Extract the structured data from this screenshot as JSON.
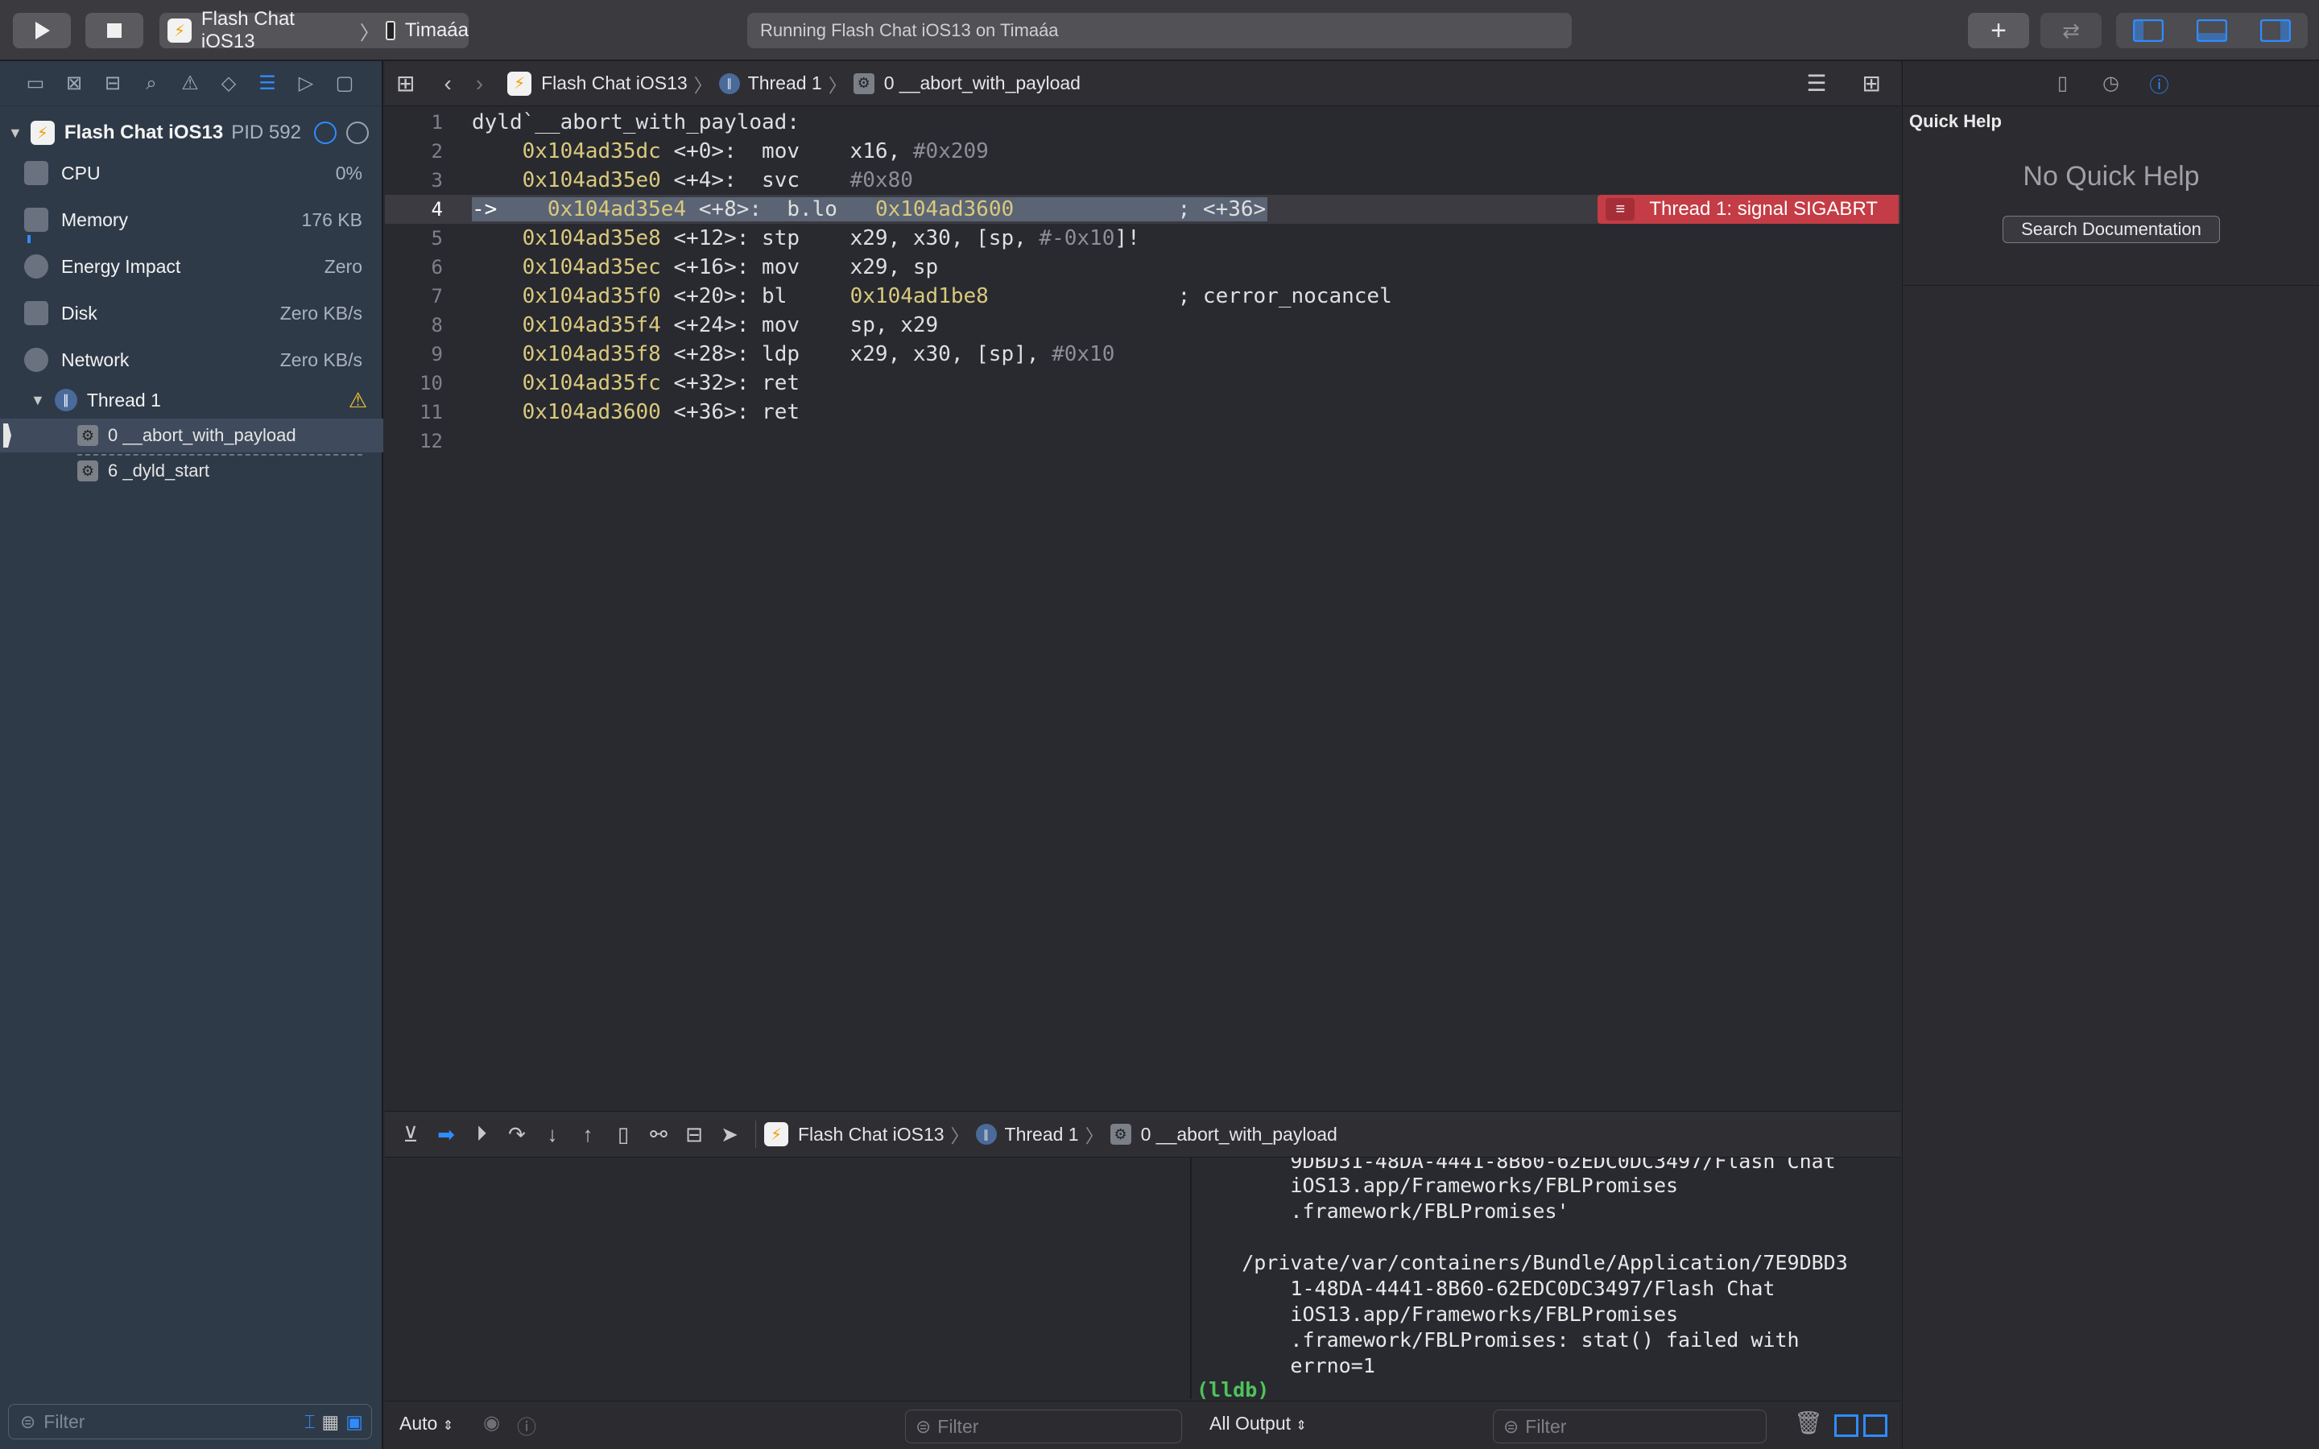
{
  "toolbar": {
    "scheme_app": "Flash Chat iOS13",
    "scheme_device": "Timaáa",
    "status": "Running Flash Chat iOS13 on Timaáa",
    "icons": [
      "run-icon",
      "stop-icon",
      "library-add-icon",
      "review-icon",
      "navigator-toggle-icon",
      "debug-toggle-icon",
      "inspector-toggle-icon"
    ]
  },
  "navigator": {
    "process": {
      "name": "Flash Chat iOS13",
      "pid": "PID 592"
    },
    "gauges": [
      {
        "label": "CPU",
        "value": "0%"
      },
      {
        "label": "Memory",
        "value": "176 KB"
      },
      {
        "label": "Energy Impact",
        "value": "Zero"
      },
      {
        "label": "Disk",
        "value": "Zero KB/s"
      },
      {
        "label": "Network",
        "value": "Zero KB/s"
      }
    ],
    "thread": "Thread 1",
    "frames": [
      "0 __abort_with_payload",
      "6 _dyld_start"
    ],
    "filter_placeholder": "Filter"
  },
  "editor": {
    "breadcrumb": [
      "Flash Chat iOS13",
      "Thread 1",
      "0 __abort_with_payload"
    ],
    "current_line": 4,
    "error": "Thread 1: signal SIGABRT",
    "lines": [
      {
        "n": "1",
        "addr": "",
        "text": "dyld`__abort_with_payload:",
        "arg": "",
        "comment": ""
      },
      {
        "n": "2",
        "addr": "    0x104ad35dc",
        "text": " <+0>:  mov    x16, ",
        "arg": "#0x209",
        "comment": ""
      },
      {
        "n": "3",
        "addr": "    0x104ad35e0",
        "text": " <+4>:  svc    ",
        "arg": "#0x80",
        "comment": ""
      },
      {
        "n": "4",
        "addr": "    0x104ad35e4",
        "text": " <+8>:  b.lo   ",
        "arg": "0x104ad3600",
        "comment": "             ; <+36>"
      },
      {
        "n": "5",
        "addr": "    0x104ad35e8",
        "text": " <+12>: stp    x29, x30, [sp, ",
        "arg": "#-0x10",
        "comment": "]!"
      },
      {
        "n": "6",
        "addr": "    0x104ad35ec",
        "text": " <+16>: mov    x29, sp",
        "arg": "",
        "comment": ""
      },
      {
        "n": "7",
        "addr": "    0x104ad35f0",
        "text": " <+20>: bl     ",
        "arg": "0x104ad1be8",
        "comment": "               ; cerror_nocancel"
      },
      {
        "n": "8",
        "addr": "    0x104ad35f4",
        "text": " <+24>: mov    sp, x29",
        "arg": "",
        "comment": ""
      },
      {
        "n": "9",
        "addr": "    0x104ad35f8",
        "text": " <+28>: ldp    x29, x30, [sp], ",
        "arg": "#0x10",
        "comment": ""
      },
      {
        "n": "10",
        "addr": "    0x104ad35fc",
        "text": " <+32>: ret",
        "arg": "",
        "comment": ""
      },
      {
        "n": "11",
        "addr": "    0x104ad3600",
        "text": " <+36>: ret",
        "arg": "",
        "comment": ""
      },
      {
        "n": "12",
        "addr": "",
        "text": "",
        "arg": "",
        "comment": ""
      }
    ]
  },
  "debug": {
    "breadcrumb": [
      "Flash Chat iOS13",
      "Thread 1",
      "0 __abort_with_payload"
    ],
    "variables_scope": "Auto",
    "variables_filter": "Filter",
    "output_scope": "All Output",
    "output_filter": "Filter",
    "console": [
      "        9DBD31-48DA-4441-8B60-62EDC0DC3497/Flash Chat",
      "        iOS13.app/Frameworks/FBLPromises",
      "        .framework/FBLPromises'",
      "",
      "    /private/var/containers/Bundle/Application/7E9DBD3",
      "        1-48DA-4441-8B60-62EDC0DC3497/Flash Chat",
      "        iOS13.app/Frameworks/FBLPromises",
      "        .framework/FBLPromises: stat() failed with",
      "        errno=1"
    ],
    "prompt": "(lldb)"
  },
  "inspector": {
    "title": "Quick Help",
    "empty": "No Quick Help",
    "search_button": "Search Documentation"
  }
}
